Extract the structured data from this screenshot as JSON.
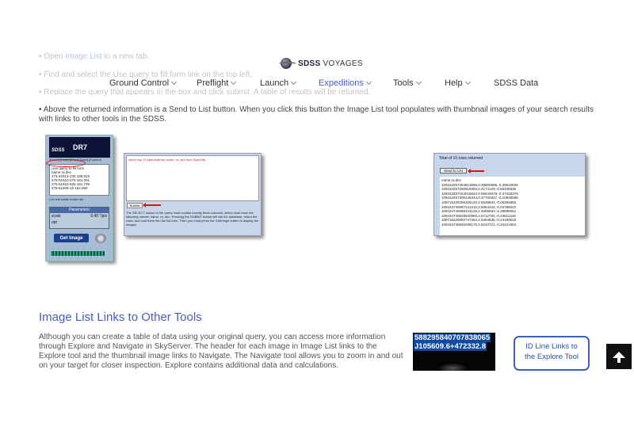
{
  "header": {
    "logo_bold": "SDSS",
    "logo_rest": "VOYAGES",
    "nav": [
      {
        "label": "Ground Control",
        "has_menu": true,
        "active": false
      },
      {
        "label": "Preflight",
        "has_menu": true,
        "active": false
      },
      {
        "label": "Launch",
        "has_menu": true,
        "active": false
      },
      {
        "label": "Expeditions",
        "has_menu": true,
        "active": true
      },
      {
        "label": "Tools",
        "has_menu": true,
        "active": false
      },
      {
        "label": "Help",
        "has_menu": true,
        "active": false
      },
      {
        "label": "SDSS Data",
        "has_menu": false,
        "active": false
      }
    ]
  },
  "faded_steps": {
    "step1_prefix": "• Open ",
    "step1_link": "Image List",
    "step1_suffix": " in a new tab.",
    "step2": "• Find and select the Use query to fill form link on the top left.",
    "step3": "• Replace the query that appears in the box and click submit.  A table of results will be returned."
  },
  "main": {
    "paragraph": "•  Above the returned information is a Send to List button.  When you click this button the Image List tool populates with thumbnail images of your search results with links to other tools in the SDSS."
  },
  "dr7_panel": {
    "sdss": "SDSS",
    "version": "DR7",
    "crumb": "[Home] [Help] [Chart]  [Navi] [Explore]",
    "use_query": "Use query to fill form",
    "list_header": "name   ra   dec",
    "list_rows": [
      "274-51913-230 159.815",
      "275-51910-275 161.001",
      "275-51910-525 161.739",
      "276-51909-19 164.090"
    ],
    "caption": "Cut and paste ranlec list",
    "params_title": "Parameters",
    "scale_label": "scale",
    "scale_value": "0.40",
    "scale_unit": "\"/pix",
    "opt_label": "opt",
    "get_image": "Get Image"
  },
  "sql_panel": {
    "query": "select top 10 specobjid as name, ra, dec from SpecObj",
    "submit": "Submit",
    "description": "The SELECT clause of the query must contain exactly three columns, which must have the following names: name, ra, dec. Pressing the SUBMIT button will call the database, return the rows, and load them into the list form. Then you must press the GetImage button to display the images."
  },
  "results_panel": {
    "title": "Total of 10 rows returned",
    "send_button": "Send to List",
    "header": "name,ra,dec",
    "rows": [
      "109153257254813696,0.39900896,-0.39510509",
      "109153257250619392,0.4174129,-0.56405935",
      "109153257164016644,0.65644678,-0.37428379",
      "109153257305145344,0.37702827,-0.10849089",
      "109716225256325120,2.6639604,-0.05284883",
      "109434740687241216,2.5054342,-0.04786022",
      "109434740698424128,2.4655593,-0.29596051",
      "109434740628520960,2.5712754,-0.23811316",
      "109716225092747264,2.5464836,-0.24189518",
      "109434740645298176,2.5243721,-0.24421653"
    ]
  },
  "section": {
    "title": "Image List Links to Other Tools",
    "paragraph": "Although you can create a table of data using your original query, you can access more information through Explore and Navigate in SkyServer.  The header for each image in Image List links to the Explore tool and the thumbnail image links to Navigate.  The Navigate tool allows you to zoom in and out on your target for closer inspection. Explore contains additional data and calculations."
  },
  "id_image": {
    "line1": "588295840707838065",
    "line2": "J105609.6+472332.8"
  },
  "callout": {
    "line1": "ID Line Links to",
    "line2": "the Explore Tool"
  },
  "colors": {
    "accent": "#4a5bc4",
    "callout_border": "#3a63b8",
    "arrow_red": "#dd1111"
  }
}
